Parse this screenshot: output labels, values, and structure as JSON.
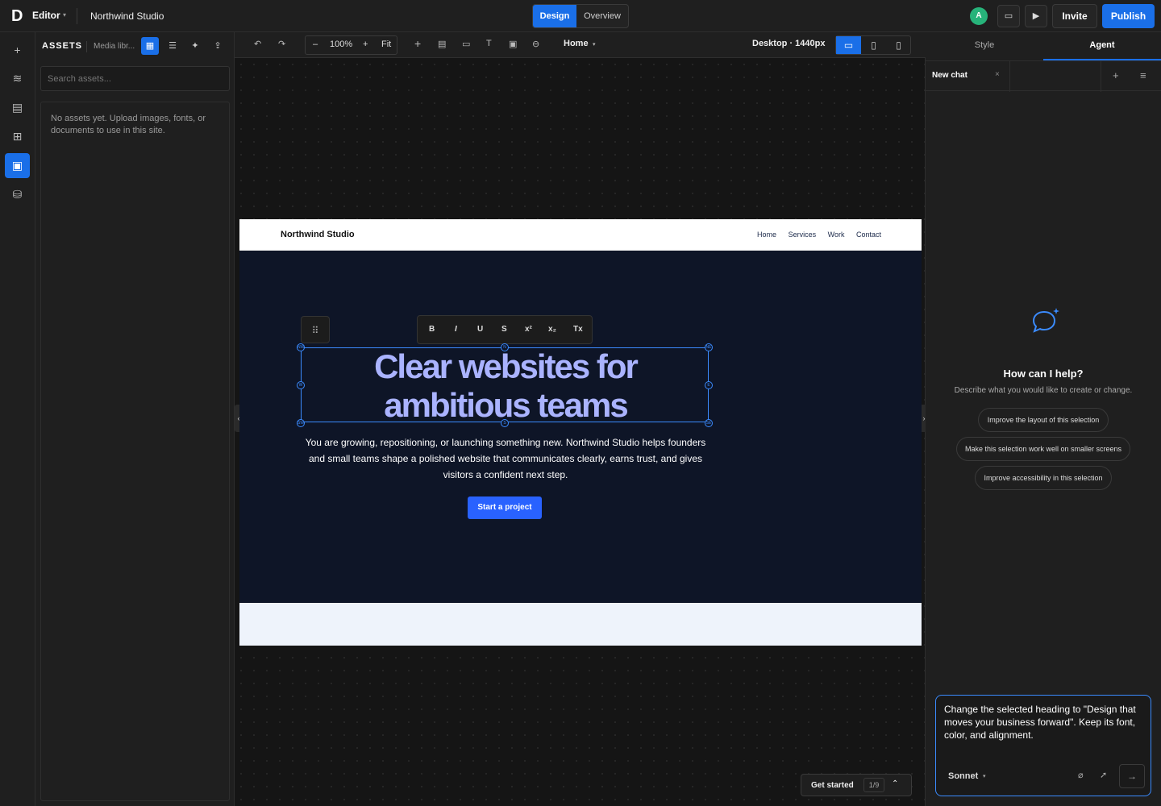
{
  "topbar": {
    "app_label": "Editor",
    "project_name": "Northwind Studio",
    "mode_tabs": [
      "Design",
      "Overview"
    ],
    "avatar_initial": "A",
    "invite_label": "Invite",
    "publish_label": "Publish",
    "accent_color": "#1a6fe8"
  },
  "left_panel": {
    "title": "ASSETS",
    "media_label": "Media libr...",
    "search_placeholder": "Search assets...",
    "empty_message": "No assets yet. Upload images, fonts, or documents to use in this site."
  },
  "canvas_toolbar": {
    "zoom": "100%",
    "fit_label": "Fit",
    "page": "Home",
    "breakpoint": "Desktop · 1440px"
  },
  "site": {
    "brand": "Northwind Studio",
    "nav": [
      "Home",
      "Services",
      "Work",
      "Contact"
    ],
    "heading": "Clear websites for ambitious teams",
    "body": "You are growing, repositioning, or launching something new. Northwind Studio helps founders and small teams shape a polished website that communicates clearly, earns trust, and gives visitors a confident next step.",
    "cta": "Start a project",
    "format_buttons": [
      "B",
      "I",
      "U",
      "S",
      "x²",
      "x₂",
      "Tx"
    ],
    "handle_labels": [
      "NW",
      "N",
      "NE",
      "W",
      "E",
      "SW",
      "S",
      "SE"
    ]
  },
  "get_started": {
    "label": "Get started",
    "count": "1/9"
  },
  "right_panel": {
    "tabs": [
      "Style",
      "Agent"
    ],
    "chat_tab": "New chat",
    "help_title": "How can I help?",
    "help_sub": "Describe what you would like to create or change.",
    "suggestions": [
      "Improve the layout of this selection",
      "Make this selection work well on smaller screens",
      "Improve accessibility in this selection"
    ],
    "prompt": "Change the selected heading to \"Design that moves your business forward\". Keep its font, color, and alignment.",
    "model": "Sonnet"
  }
}
